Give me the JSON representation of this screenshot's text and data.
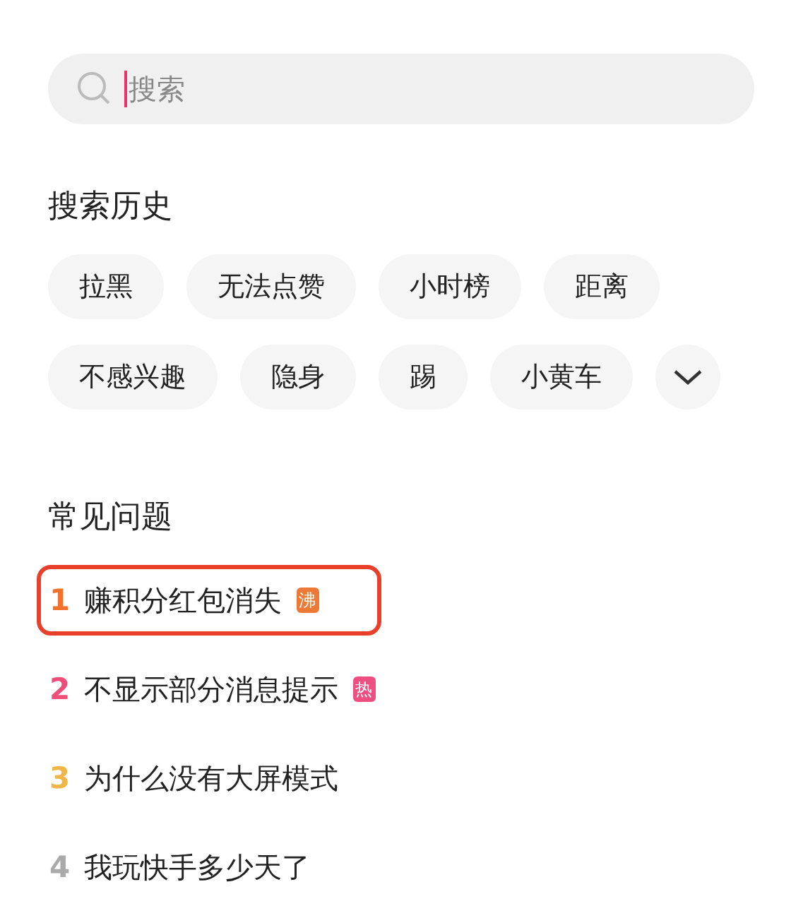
{
  "search": {
    "placeholder": "搜索"
  },
  "history": {
    "title": "搜索历史",
    "tags": [
      "拉黑",
      "无法点赞",
      "小时榜",
      "距离",
      "不感兴趣",
      "隐身",
      "踢",
      "小黄车"
    ],
    "expanded": false
  },
  "faq": {
    "title": "常见问题",
    "items": [
      {
        "rank": "1",
        "color": "#f0722c",
        "text": "赚积分红包消失",
        "badge": {
          "text": "沸",
          "color": "#ec7a36"
        },
        "highlighted": true
      },
      {
        "rank": "2",
        "color": "#ef4d7a",
        "text": "不显示部分消息提示",
        "badge": {
          "text": "热",
          "color": "#ee4f80"
        },
        "highlighted": false
      },
      {
        "rank": "3",
        "color": "#f1b648",
        "text": "为什么没有大屏模式",
        "highlighted": false
      },
      {
        "rank": "4",
        "color": "#aaaaaa",
        "text": "我玩快手多少天了",
        "highlighted": false
      }
    ]
  }
}
